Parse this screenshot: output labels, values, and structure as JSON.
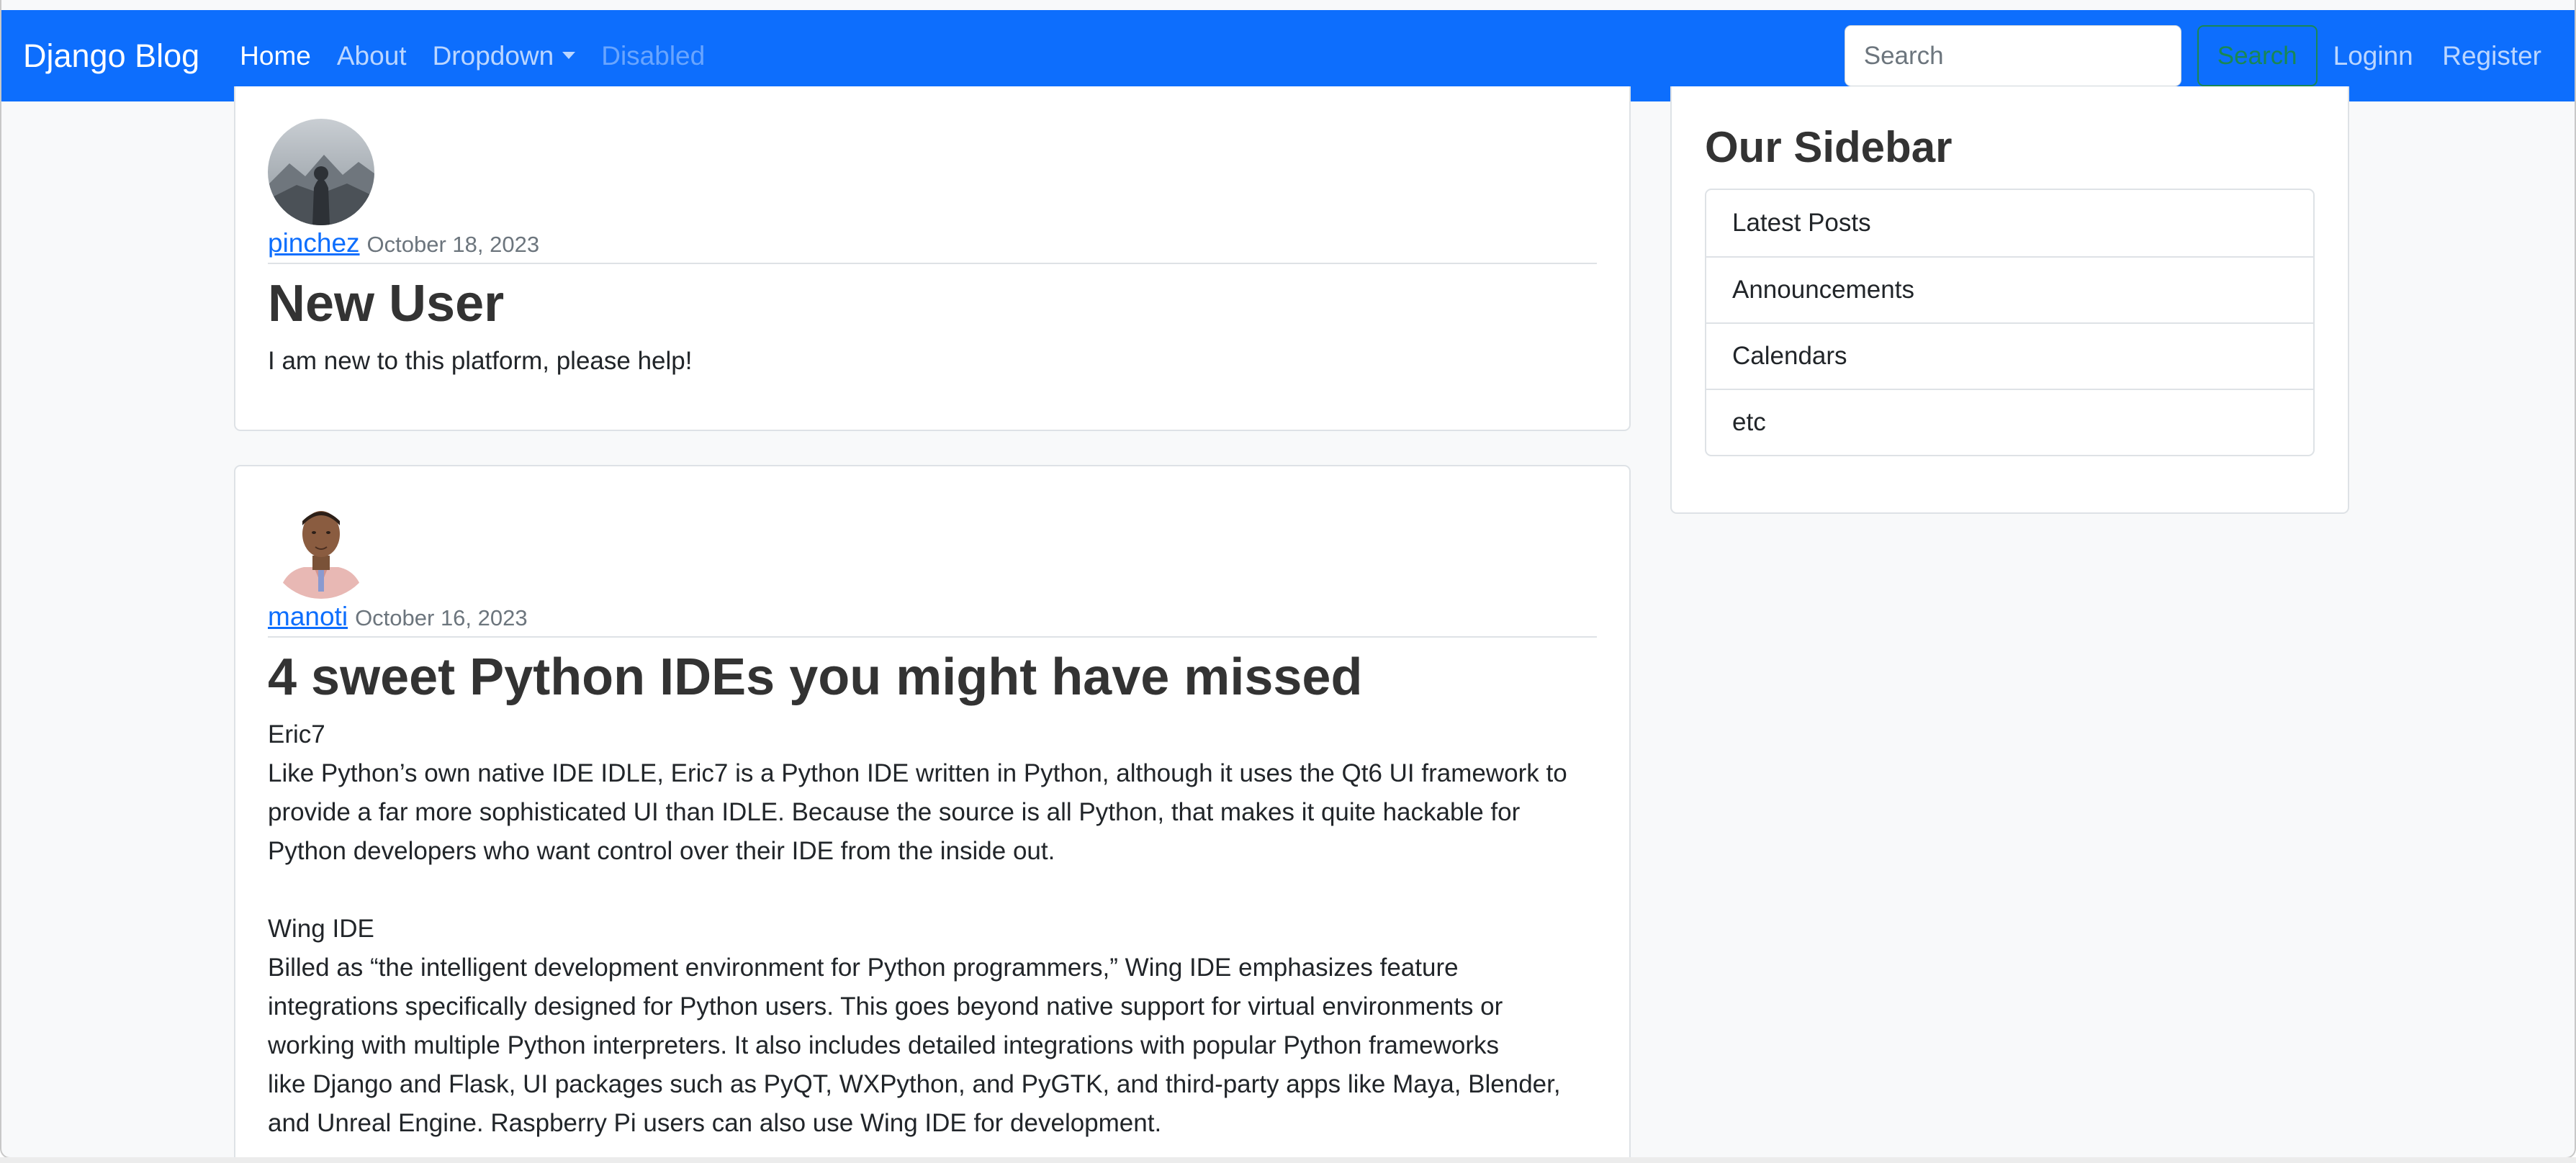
{
  "navbar": {
    "brand": "Django Blog",
    "links": [
      {
        "label": "Home"
      },
      {
        "label": "About"
      },
      {
        "label": "Dropdown"
      },
      {
        "label": "Disabled"
      }
    ],
    "search": {
      "placeholder": "Search",
      "value": "",
      "button_label": "Search"
    },
    "right_links": [
      {
        "label": "Loginn"
      },
      {
        "label": "Register"
      }
    ],
    "colors": {
      "background": "#0d6efd",
      "search_button": "#198754"
    }
  },
  "posts": [
    {
      "author": "pinchez",
      "date": "October 18, 2023",
      "title": "New User",
      "content": "I am new to this platform, please help!"
    },
    {
      "author": "manoti",
      "date": "October 16, 2023",
      "title": "4 sweet Python IDEs you might have missed",
      "content": "Eric7\nLike Python’s own native IDE IDLE, Eric7 is a Python IDE written in Python, although it uses the Qt6 UI framework to\nprovide a far more sophisticated UI than IDLE. Because the source is all Python, that makes it quite hackable for\nPython developers who want control over their IDE from the inside out.\n\nWing IDE\nBilled as “the intelligent development environment for Python programmers,” Wing IDE emphasizes feature\nintegrations specifically designed for Python users. This goes beyond native support for virtual environments or\nworking with multiple Python interpreters. It also includes detailed integrations with popular Python frameworks\nlike Django and Flask, UI packages such as PyQT, WXPython, and PyGTK, and third-party apps like Maya, Blender,\nand Unreal Engine. Raspberry Pi users can also use Wing IDE for development."
    }
  ],
  "sidebar": {
    "title": "Our Sidebar",
    "items": [
      {
        "label": "Latest Posts"
      },
      {
        "label": "Announcements"
      },
      {
        "label": "Calendars"
      },
      {
        "label": "etc"
      }
    ]
  }
}
